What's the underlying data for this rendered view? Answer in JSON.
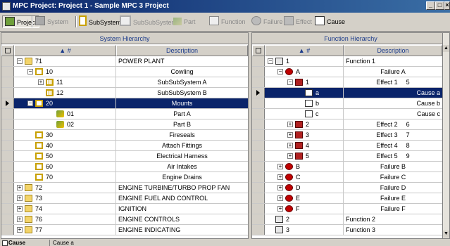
{
  "window": {
    "title": "MPC Project: Project 1 - Sample MPC 3 Project",
    "buttons": {
      "minimize": "_",
      "maximize": "□",
      "close": "×"
    }
  },
  "toolbar": {
    "items": [
      {
        "label": "Project",
        "enabled": true,
        "pressed": true,
        "icon": "project-icon"
      },
      {
        "label": "System",
        "enabled": false,
        "pressed": false,
        "icon": "system-icon"
      },
      {
        "label": "SubSystem",
        "enabled": true,
        "pressed": false,
        "icon": "subsystem-icon"
      },
      {
        "label": "SubSubSystem",
        "enabled": false,
        "pressed": false,
        "icon": "subsubsystem-icon"
      },
      {
        "label": "Part",
        "enabled": false,
        "pressed": false,
        "icon": "part-icon"
      },
      {
        "label": "Function",
        "enabled": false,
        "pressed": false,
        "icon": "function-icon"
      },
      {
        "label": "Failure",
        "enabled": false,
        "pressed": false,
        "icon": "failure-icon"
      },
      {
        "label": "Effect",
        "enabled": false,
        "pressed": false,
        "icon": "effect-icon"
      },
      {
        "label": "Cause",
        "enabled": true,
        "pressed": false,
        "icon": "cause-icon"
      }
    ]
  },
  "system_hierarchy": {
    "title": "System Hierarchy",
    "columns": {
      "number": "▲ #",
      "description": "Description"
    },
    "rows": [
      {
        "num": "71",
        "desc": "POWER PLANT",
        "icon": "folder-icon",
        "level": 0,
        "expander": "−",
        "selected": false,
        "align": "left"
      },
      {
        "num": "10",
        "desc": "Cowling",
        "icon": "subsystem-icon",
        "level": 1,
        "expander": "−",
        "selected": false,
        "align": "center"
      },
      {
        "num": "11",
        "desc": "SubSubSystem A",
        "icon": "subsubsystem-icon",
        "level": 2,
        "expander": "+",
        "selected": false,
        "align": "center"
      },
      {
        "num": "12",
        "desc": "SubSubSystem B",
        "icon": "subsubsystem-icon",
        "level": 2,
        "expander": "",
        "selected": false,
        "align": "center"
      },
      {
        "num": "20",
        "desc": "Mounts",
        "icon": "subsystem-icon",
        "level": 1,
        "expander": "−",
        "selected": true,
        "align": "center"
      },
      {
        "num": "01",
        "desc": "Part A",
        "icon": "part-icon",
        "level": 3,
        "expander": "",
        "selected": false,
        "align": "center"
      },
      {
        "num": "02",
        "desc": "Part B",
        "icon": "part-icon",
        "level": 3,
        "expander": "",
        "selected": false,
        "align": "center"
      },
      {
        "num": "30",
        "desc": "Fireseals",
        "icon": "subsystem-icon",
        "level": 1,
        "expander": "",
        "selected": false,
        "align": "center"
      },
      {
        "num": "40",
        "desc": "Attach Fittings",
        "icon": "subsystem-icon",
        "level": 1,
        "expander": "",
        "selected": false,
        "align": "center"
      },
      {
        "num": "50",
        "desc": "Electrical Harness",
        "icon": "subsystem-icon",
        "level": 1,
        "expander": "",
        "selected": false,
        "align": "center"
      },
      {
        "num": "60",
        "desc": "Air Intakes",
        "icon": "subsystem-icon",
        "level": 1,
        "expander": "",
        "selected": false,
        "align": "center"
      },
      {
        "num": "70",
        "desc": "Engine Drains",
        "icon": "subsystem-icon",
        "level": 1,
        "expander": "",
        "selected": false,
        "align": "center"
      },
      {
        "num": "72",
        "desc": "ENGINE TURBINE/TURBO PROP FAN",
        "icon": "folder-icon",
        "level": 0,
        "expander": "+",
        "selected": false,
        "align": "left"
      },
      {
        "num": "73",
        "desc": "ENGINE FUEL AND CONTROL",
        "icon": "folder-icon",
        "level": 0,
        "expander": "+",
        "selected": false,
        "align": "left"
      },
      {
        "num": "74",
        "desc": "IGNITION",
        "icon": "folder-icon",
        "level": 0,
        "expander": "+",
        "selected": false,
        "align": "left"
      },
      {
        "num": "76",
        "desc": "ENGINE CONTROLS",
        "icon": "folder-icon",
        "level": 0,
        "expander": "+",
        "selected": false,
        "align": "left"
      },
      {
        "num": "77",
        "desc": "ENGINE INDICATING",
        "icon": "folder-icon",
        "level": 0,
        "expander": "+",
        "selected": false,
        "align": "left"
      }
    ]
  },
  "function_hierarchy": {
    "title": "Function Hierarchy",
    "columns": {
      "number": "▲ #",
      "description": "Description"
    },
    "rows": [
      {
        "num": "1",
        "desc": "Function 1",
        "extra": "",
        "icon": "function-icon",
        "level": 0,
        "expander": "−",
        "selected": false,
        "align": "left"
      },
      {
        "num": "A",
        "desc": "Failure A",
        "extra": "",
        "icon": "failure-icon",
        "level": 1,
        "expander": "−",
        "selected": false,
        "align": "center"
      },
      {
        "num": "1",
        "desc": "Effect 1",
        "extra": "5",
        "icon": "effect-icon",
        "level": 2,
        "expander": "−",
        "selected": false,
        "align": "center"
      },
      {
        "num": "a",
        "desc": "Cause a",
        "extra": "",
        "icon": "cause-icon",
        "level": 3,
        "expander": "",
        "selected": true,
        "align": "right"
      },
      {
        "num": "b",
        "desc": "Cause b",
        "extra": "",
        "icon": "cause-icon",
        "level": 3,
        "expander": "",
        "selected": false,
        "align": "right"
      },
      {
        "num": "c",
        "desc": "Cause c",
        "extra": "",
        "icon": "cause-icon",
        "level": 3,
        "expander": "",
        "selected": false,
        "align": "right"
      },
      {
        "num": "2",
        "desc": "Effect 2",
        "extra": "6",
        "icon": "effect-icon",
        "level": 2,
        "expander": "+",
        "selected": false,
        "align": "center"
      },
      {
        "num": "3",
        "desc": "Effect 3",
        "extra": "7",
        "icon": "effect-icon",
        "level": 2,
        "expander": "+",
        "selected": false,
        "align": "center"
      },
      {
        "num": "4",
        "desc": "Effect 4",
        "extra": "8",
        "icon": "effect-icon",
        "level": 2,
        "expander": "+",
        "selected": false,
        "align": "center"
      },
      {
        "num": "5",
        "desc": "Effect 5",
        "extra": "9",
        "icon": "effect-icon",
        "level": 2,
        "expander": "+",
        "selected": false,
        "align": "center"
      },
      {
        "num": "B",
        "desc": "Failure B",
        "extra": "",
        "icon": "failure-icon",
        "level": 1,
        "expander": "+",
        "selected": false,
        "align": "center"
      },
      {
        "num": "C",
        "desc": "Failure C",
        "extra": "",
        "icon": "failure-icon",
        "level": 1,
        "expander": "+",
        "selected": false,
        "align": "center"
      },
      {
        "num": "D",
        "desc": "Failure D",
        "extra": "",
        "icon": "failure-icon",
        "level": 1,
        "expander": "+",
        "selected": false,
        "align": "center"
      },
      {
        "num": "E",
        "desc": "Failure E",
        "extra": "",
        "icon": "failure-icon",
        "level": 1,
        "expander": "+",
        "selected": false,
        "align": "center"
      },
      {
        "num": "F",
        "desc": "Failure F",
        "extra": "",
        "icon": "failure-icon",
        "level": 1,
        "expander": "+",
        "selected": false,
        "align": "center"
      },
      {
        "num": "2",
        "desc": "Function 2",
        "extra": "",
        "icon": "function-icon",
        "level": 0,
        "expander": "",
        "selected": false,
        "align": "left"
      },
      {
        "num": "3",
        "desc": "Function 3",
        "extra": "",
        "icon": "function-icon",
        "level": 0,
        "expander": "",
        "selected": false,
        "align": "left"
      }
    ]
  },
  "status_bar": {
    "type": "Cause",
    "value": "Cause a"
  },
  "colors": {
    "selection": "#0a246a",
    "titlebar": "#0a246a",
    "desktop": "#7fb2c8",
    "header_text": "#1a3a8a"
  }
}
